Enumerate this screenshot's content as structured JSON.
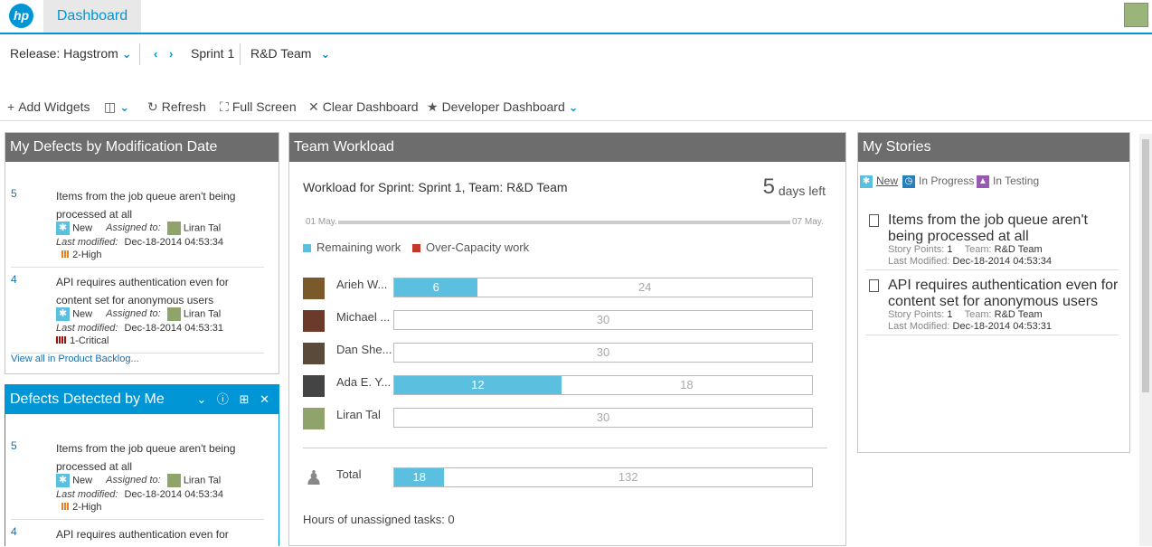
{
  "app": {
    "logo": "hp",
    "tab": "Dashboard"
  },
  "context": {
    "release": "Release: Hagstrom",
    "sprint": "Sprint 1",
    "team": "R&D Team"
  },
  "toolbar": {
    "add": "Add Widgets",
    "refresh": "Refresh",
    "fullscreen": "Full Screen",
    "clear": "Clear Dashboard",
    "dashboard": "Developer Dashboard"
  },
  "defects_by_date": {
    "title": "My Defects by Modification Date",
    "items": [
      {
        "id": "5",
        "title": "Items from the job queue aren't being processed at all",
        "status": "New",
        "assigned_label": "Assigned to:",
        "assignee": "Liran Tal",
        "modified_label": "Last modified:",
        "modified": "Dec-18-2014 04:53:34",
        "severity": "2-High"
      },
      {
        "id": "4",
        "title": "API requires authentication even for content set for anonymous users",
        "status": "New",
        "assigned_label": "Assigned to:",
        "assignee": "Liran Tal",
        "modified_label": "Last modified:",
        "modified": "Dec-18-2014 04:53:31",
        "severity": "1-Critical"
      }
    ],
    "view_all": "View all in Product Backlog..."
  },
  "defects_by_me": {
    "title": "Defects Detected by Me",
    "items": [
      {
        "id": "5",
        "title": "Items from the job queue aren't being processed at all",
        "status": "New",
        "assigned_label": "Assigned to:",
        "assignee": "Liran Tal",
        "modified_label": "Last modified:",
        "modified": "Dec-18-2014 04:53:34",
        "severity": "2-High"
      },
      {
        "id": "4",
        "title": "API requires authentication even for"
      }
    ]
  },
  "workload": {
    "title": "Team Workload",
    "heading": "Workload for Sprint: Sprint 1, Team: R&D Team",
    "days": "5",
    "days_label": "days left",
    "start": "01 May.",
    "end": "07 May.",
    "legend_remaining": "Remaining work",
    "legend_over": "Over-Capacity work",
    "members": [
      {
        "name": "Arieh W...",
        "remaining": 6,
        "free": 24,
        "remaining_label": "6",
        "free_label": "24"
      },
      {
        "name": "Michael ...",
        "remaining": 0,
        "free": 30,
        "remaining_label": "",
        "free_label": "30"
      },
      {
        "name": "Dan She...",
        "remaining": 0,
        "free": 30,
        "remaining_label": "",
        "free_label": "30"
      },
      {
        "name": "Ada E. Y...",
        "remaining": 12,
        "free": 18,
        "remaining_label": "12",
        "free_label": "18"
      },
      {
        "name": "Liran Tal",
        "remaining": 0,
        "free": 30,
        "remaining_label": "",
        "free_label": "30"
      }
    ],
    "total": {
      "name": "Total",
      "remaining": 18,
      "free": 132,
      "remaining_label": "18",
      "free_label": "132"
    },
    "unassigned": "Hours of unassigned tasks: 0",
    "colors": {
      "remaining": "#5bbfe0",
      "over": "#c0392b"
    }
  },
  "stories": {
    "title": "My Stories",
    "filters": {
      "new": "New",
      "in_progress": "In Progress",
      "in_testing": "In Testing"
    },
    "items": [
      {
        "title": "Items from the job queue aren't being processed at all",
        "sp_label": "Story Points:",
        "sp": "1",
        "team_label": "Team:",
        "team": "R&D Team",
        "mod_label": "Last Modified:",
        "mod": "Dec-18-2014 04:53:34"
      },
      {
        "title": "API requires authentication even for content set for anonymous users",
        "sp_label": "Story Points:",
        "sp": "1",
        "team_label": "Team:",
        "team": "R&D Team",
        "mod_label": "Last Modified:",
        "mod": "Dec-18-2014 04:53:31"
      }
    ]
  }
}
